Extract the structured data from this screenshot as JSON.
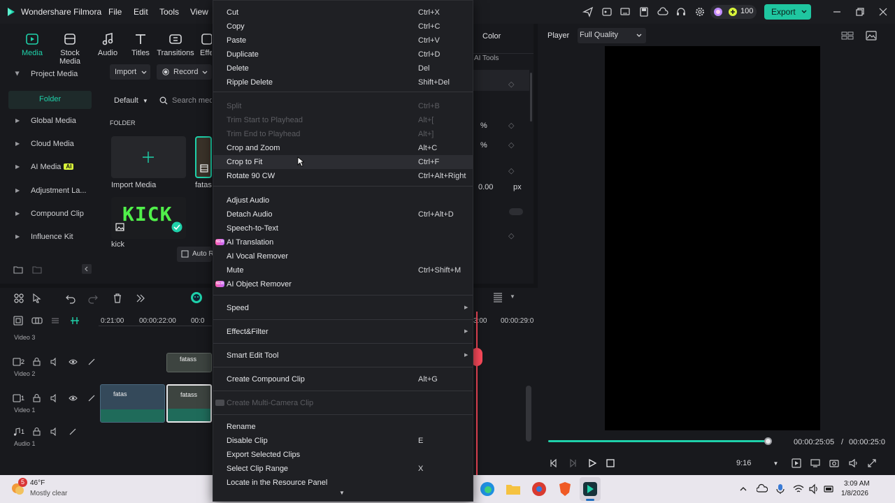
{
  "app": {
    "title": "Wondershare Filmora",
    "menus": [
      "File",
      "Edit",
      "Tools",
      "View"
    ]
  },
  "toolbar": {
    "credits": "100",
    "export_label": "Export"
  },
  "media_tabs": [
    {
      "label": "Media",
      "icon": "media-icon",
      "active": true
    },
    {
      "label": "Stock Media",
      "icon": "stock-media-icon",
      "active": false
    },
    {
      "label": "Audio",
      "icon": "music-note-icon",
      "active": false
    },
    {
      "label": "Titles",
      "icon": "text-icon",
      "active": false
    },
    {
      "label": "Transitions",
      "icon": "transitions-icon",
      "active": false
    },
    {
      "label": "Effe",
      "icon": "effects-icon",
      "active": false
    }
  ],
  "media_nav": {
    "project_media": "Project Media",
    "folder": "Folder",
    "items": [
      "Global Media",
      "Cloud Media",
      "AI Media",
      "Adjustment La...",
      "Compound Clip",
      "Influence Kit"
    ],
    "ai_badge": "AI"
  },
  "media_toolbar": {
    "import": "Import",
    "record": "Record",
    "sort": "Default",
    "search_placeholder": "Search media",
    "folder_heading": "FOLDER",
    "auto_label": "Auto Re"
  },
  "media_items": [
    {
      "label": "Import Media"
    },
    {
      "label": "fatass"
    },
    {
      "label": "kick",
      "thumb_text": "KICK"
    }
  ],
  "properties": {
    "color_tab": "Color",
    "ai_tools": "AI Tools",
    "unit_percent": "%",
    "offset_value": "0.00",
    "unit_px": "px"
  },
  "player": {
    "label": "Player",
    "quality": "Full Quality",
    "current_time": "00:00:25:05",
    "separator": "/",
    "total_time": "00:00:25:0",
    "aspect": "9:16",
    "progress": 0.98
  },
  "timeline": {
    "ruler": [
      "0:21:00",
      "00:00:22:00",
      "00:0",
      "3:00",
      "00:00:29:0"
    ],
    "tracks": [
      {
        "name": "Video 3",
        "index": ""
      },
      {
        "name": "Video 2",
        "index": "2"
      },
      {
        "name": "Video 1",
        "index": "1"
      },
      {
        "name": "Audio 1",
        "index": "1"
      }
    ],
    "clip_title": "fatass",
    "clip_title_short": "fatas"
  },
  "context_menu": {
    "items": [
      {
        "label": "Cut",
        "shortcut": "Ctrl+X"
      },
      {
        "label": "Copy",
        "shortcut": "Ctrl+C"
      },
      {
        "label": "Paste",
        "shortcut": "Ctrl+V"
      },
      {
        "label": "Duplicate",
        "shortcut": "Ctrl+D"
      },
      {
        "label": "Delete",
        "shortcut": "Del"
      },
      {
        "label": "Ripple Delete",
        "shortcut": "Shift+Del"
      },
      {
        "label": "Split",
        "shortcut": "Ctrl+B",
        "disabled": true
      },
      {
        "label": "Trim Start to Playhead",
        "shortcut": "Alt+[",
        "disabled": true
      },
      {
        "label": "Trim End to Playhead",
        "shortcut": "Alt+]",
        "disabled": true
      },
      {
        "label": "Crop and Zoom",
        "shortcut": "Alt+C"
      },
      {
        "label": "Crop to Fit",
        "shortcut": "Ctrl+F",
        "hover": true
      },
      {
        "label": "Rotate 90 CW",
        "shortcut": "Ctrl+Alt+Right"
      },
      {
        "label": "Adjust Audio",
        "shortcut": ""
      },
      {
        "label": "Detach Audio",
        "shortcut": "Ctrl+Alt+D"
      },
      {
        "label": "Speech-to-Text",
        "shortcut": ""
      },
      {
        "label": "AI Translation",
        "shortcut": "",
        "badge": "NEW"
      },
      {
        "label": "AI Vocal Remover",
        "shortcut": ""
      },
      {
        "label": "Mute",
        "shortcut": "Ctrl+Shift+M"
      },
      {
        "label": "AI Object Remover",
        "shortcut": "",
        "badge": "NEW"
      },
      {
        "label": "Speed",
        "shortcut": "",
        "submenu": true
      },
      {
        "label": "Effect&Filter",
        "shortcut": "",
        "submenu": true
      },
      {
        "label": "Smart Edit Tool",
        "shortcut": "",
        "submenu": true
      },
      {
        "label": "Create Compound Clip",
        "shortcut": "Alt+G"
      },
      {
        "label": "Create Multi-Camera Clip",
        "shortcut": "",
        "disabled": true
      },
      {
        "label": "Rename",
        "shortcut": ""
      },
      {
        "label": "Disable Clip",
        "shortcut": "E"
      },
      {
        "label": "Export Selected Clips",
        "shortcut": ""
      },
      {
        "label": "Select Clip Range",
        "shortcut": "X"
      },
      {
        "label": "Locate in the Resource Panel",
        "shortcut": ""
      }
    ]
  },
  "taskbar": {
    "weather_badge": "5",
    "temperature": "46°F",
    "condition": "Mostly clear",
    "time": "3:09 AM",
    "date": "1/8/2026"
  },
  "colors": {
    "accent": "#1fd1aa",
    "export": "#1fc6a0",
    "playhead": "#ff4b5c",
    "menu_bg": "#1f2024"
  }
}
